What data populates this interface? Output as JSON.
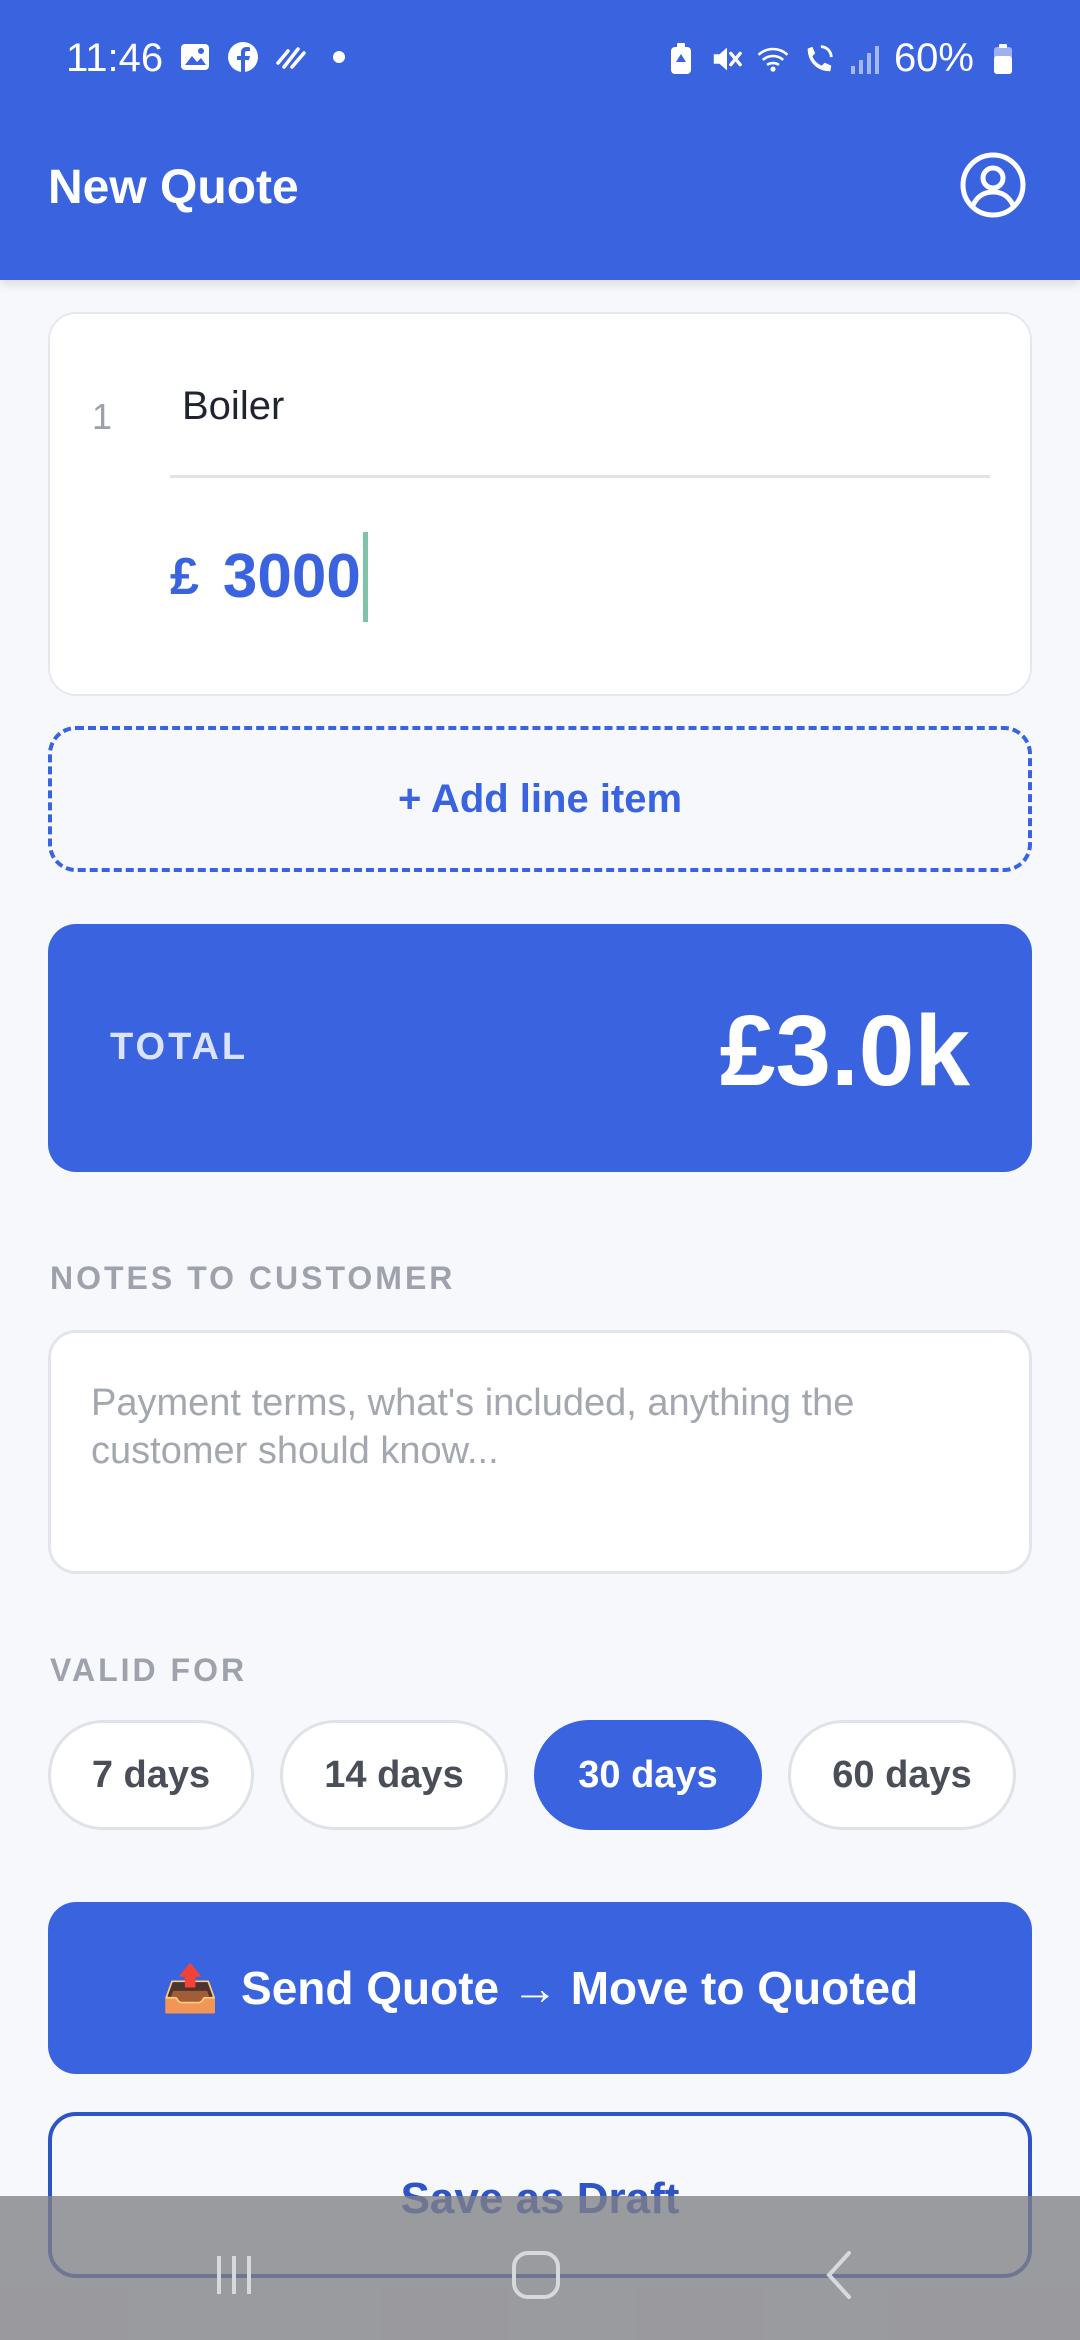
{
  "status_bar": {
    "time": "11:46",
    "battery": "60%",
    "left_icons": [
      "gallery-icon",
      "facebook-icon",
      "pulse-icon",
      "dot-icon"
    ],
    "right_icons": [
      "battery-saver-icon",
      "mute-icon",
      "wifi-icon",
      "wifi-call-icon",
      "signal-icon",
      "battery-icon"
    ]
  },
  "header": {
    "title": "New Quote",
    "profile_icon": "account-circle-icon"
  },
  "line_item": {
    "index": "1",
    "name": "Boiler",
    "currency": "£",
    "price": "3000"
  },
  "add_line_label": "+ Add line item",
  "total": {
    "label": "TOTAL",
    "value": "£3.0k"
  },
  "notes": {
    "label": "NOTES TO CUSTOMER",
    "placeholder": "Payment terms, what's included, anything the customer should know..."
  },
  "valid_for": {
    "label": "VALID FOR",
    "options": [
      "7 days",
      "14 days",
      "30 days",
      "60 days"
    ],
    "selected": "30 days"
  },
  "actions": {
    "send_icon": "📤",
    "send_label": "Send Quote → Move to Quoted",
    "draft_label": "Save as Draft"
  },
  "colors": {
    "primary": "#3a63e0",
    "accent_cursor": "#7fc3a8",
    "background": "#f7f8fc"
  }
}
